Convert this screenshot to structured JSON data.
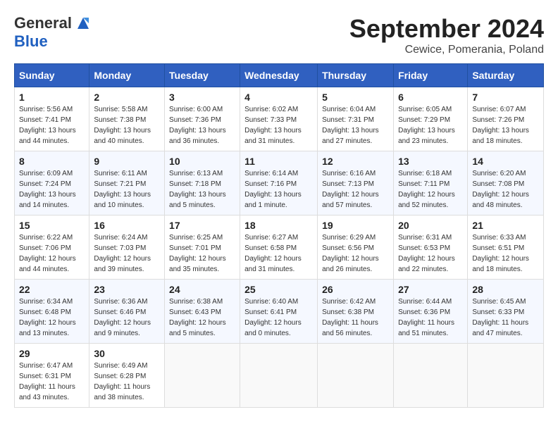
{
  "header": {
    "logo_general": "General",
    "logo_blue": "Blue",
    "month_title": "September 2024",
    "subtitle": "Cewice, Pomerania, Poland"
  },
  "calendar": {
    "days_of_week": [
      "Sunday",
      "Monday",
      "Tuesday",
      "Wednesday",
      "Thursday",
      "Friday",
      "Saturday"
    ],
    "weeks": [
      [
        {
          "day": "1",
          "sunrise": "Sunrise: 5:56 AM",
          "sunset": "Sunset: 7:41 PM",
          "daylight": "Daylight: 13 hours and 44 minutes."
        },
        {
          "day": "2",
          "sunrise": "Sunrise: 5:58 AM",
          "sunset": "Sunset: 7:38 PM",
          "daylight": "Daylight: 13 hours and 40 minutes."
        },
        {
          "day": "3",
          "sunrise": "Sunrise: 6:00 AM",
          "sunset": "Sunset: 7:36 PM",
          "daylight": "Daylight: 13 hours and 36 minutes."
        },
        {
          "day": "4",
          "sunrise": "Sunrise: 6:02 AM",
          "sunset": "Sunset: 7:33 PM",
          "daylight": "Daylight: 13 hours and 31 minutes."
        },
        {
          "day": "5",
          "sunrise": "Sunrise: 6:04 AM",
          "sunset": "Sunset: 7:31 PM",
          "daylight": "Daylight: 13 hours and 27 minutes."
        },
        {
          "day": "6",
          "sunrise": "Sunrise: 6:05 AM",
          "sunset": "Sunset: 7:29 PM",
          "daylight": "Daylight: 13 hours and 23 minutes."
        },
        {
          "day": "7",
          "sunrise": "Sunrise: 6:07 AM",
          "sunset": "Sunset: 7:26 PM",
          "daylight": "Daylight: 13 hours and 18 minutes."
        }
      ],
      [
        {
          "day": "8",
          "sunrise": "Sunrise: 6:09 AM",
          "sunset": "Sunset: 7:24 PM",
          "daylight": "Daylight: 13 hours and 14 minutes."
        },
        {
          "day": "9",
          "sunrise": "Sunrise: 6:11 AM",
          "sunset": "Sunset: 7:21 PM",
          "daylight": "Daylight: 13 hours and 10 minutes."
        },
        {
          "day": "10",
          "sunrise": "Sunrise: 6:13 AM",
          "sunset": "Sunset: 7:18 PM",
          "daylight": "Daylight: 13 hours and 5 minutes."
        },
        {
          "day": "11",
          "sunrise": "Sunrise: 6:14 AM",
          "sunset": "Sunset: 7:16 PM",
          "daylight": "Daylight: 13 hours and 1 minute."
        },
        {
          "day": "12",
          "sunrise": "Sunrise: 6:16 AM",
          "sunset": "Sunset: 7:13 PM",
          "daylight": "Daylight: 12 hours and 57 minutes."
        },
        {
          "day": "13",
          "sunrise": "Sunrise: 6:18 AM",
          "sunset": "Sunset: 7:11 PM",
          "daylight": "Daylight: 12 hours and 52 minutes."
        },
        {
          "day": "14",
          "sunrise": "Sunrise: 6:20 AM",
          "sunset": "Sunset: 7:08 PM",
          "daylight": "Daylight: 12 hours and 48 minutes."
        }
      ],
      [
        {
          "day": "15",
          "sunrise": "Sunrise: 6:22 AM",
          "sunset": "Sunset: 7:06 PM",
          "daylight": "Daylight: 12 hours and 44 minutes."
        },
        {
          "day": "16",
          "sunrise": "Sunrise: 6:24 AM",
          "sunset": "Sunset: 7:03 PM",
          "daylight": "Daylight: 12 hours and 39 minutes."
        },
        {
          "day": "17",
          "sunrise": "Sunrise: 6:25 AM",
          "sunset": "Sunset: 7:01 PM",
          "daylight": "Daylight: 12 hours and 35 minutes."
        },
        {
          "day": "18",
          "sunrise": "Sunrise: 6:27 AM",
          "sunset": "Sunset: 6:58 PM",
          "daylight": "Daylight: 12 hours and 31 minutes."
        },
        {
          "day": "19",
          "sunrise": "Sunrise: 6:29 AM",
          "sunset": "Sunset: 6:56 PM",
          "daylight": "Daylight: 12 hours and 26 minutes."
        },
        {
          "day": "20",
          "sunrise": "Sunrise: 6:31 AM",
          "sunset": "Sunset: 6:53 PM",
          "daylight": "Daylight: 12 hours and 22 minutes."
        },
        {
          "day": "21",
          "sunrise": "Sunrise: 6:33 AM",
          "sunset": "Sunset: 6:51 PM",
          "daylight": "Daylight: 12 hours and 18 minutes."
        }
      ],
      [
        {
          "day": "22",
          "sunrise": "Sunrise: 6:34 AM",
          "sunset": "Sunset: 6:48 PM",
          "daylight": "Daylight: 12 hours and 13 minutes."
        },
        {
          "day": "23",
          "sunrise": "Sunrise: 6:36 AM",
          "sunset": "Sunset: 6:46 PM",
          "daylight": "Daylight: 12 hours and 9 minutes."
        },
        {
          "day": "24",
          "sunrise": "Sunrise: 6:38 AM",
          "sunset": "Sunset: 6:43 PM",
          "daylight": "Daylight: 12 hours and 5 minutes."
        },
        {
          "day": "25",
          "sunrise": "Sunrise: 6:40 AM",
          "sunset": "Sunset: 6:41 PM",
          "daylight": "Daylight: 12 hours and 0 minutes."
        },
        {
          "day": "26",
          "sunrise": "Sunrise: 6:42 AM",
          "sunset": "Sunset: 6:38 PM",
          "daylight": "Daylight: 11 hours and 56 minutes."
        },
        {
          "day": "27",
          "sunrise": "Sunrise: 6:44 AM",
          "sunset": "Sunset: 6:36 PM",
          "daylight": "Daylight: 11 hours and 51 minutes."
        },
        {
          "day": "28",
          "sunrise": "Sunrise: 6:45 AM",
          "sunset": "Sunset: 6:33 PM",
          "daylight": "Daylight: 11 hours and 47 minutes."
        }
      ],
      [
        {
          "day": "29",
          "sunrise": "Sunrise: 6:47 AM",
          "sunset": "Sunset: 6:31 PM",
          "daylight": "Daylight: 11 hours and 43 minutes."
        },
        {
          "day": "30",
          "sunrise": "Sunrise: 6:49 AM",
          "sunset": "Sunset: 6:28 PM",
          "daylight": "Daylight: 11 hours and 38 minutes."
        },
        null,
        null,
        null,
        null,
        null
      ]
    ]
  }
}
